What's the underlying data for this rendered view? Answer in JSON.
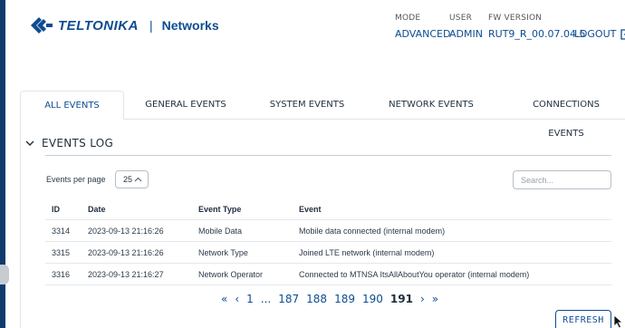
{
  "brand": {
    "logo_text": "TELTONIKA",
    "separator": "|",
    "product": "Networks",
    "color": "#0e4c92"
  },
  "header": {
    "mode": {
      "caption": "MODE",
      "value": "ADVANCED"
    },
    "user": {
      "caption": "USER",
      "value": "ADMIN"
    },
    "fw": {
      "caption": "FW VERSION",
      "value": "RUT9_R_00.07.04.5"
    },
    "logout_label": "LOGOUT",
    "logout_icon": "logout-icon"
  },
  "tabs": [
    {
      "label": "ALL EVENTS",
      "active": true
    },
    {
      "label": "GENERAL EVENTS",
      "active": false
    },
    {
      "label": "SYSTEM EVENTS",
      "active": false
    },
    {
      "label": "NETWORK EVENTS",
      "active": false
    },
    {
      "label": "CONNECTIONS EVENTS",
      "active": false
    }
  ],
  "section": {
    "title": "EVENTS LOG",
    "icon": "chevron-down-icon"
  },
  "controls": {
    "per_page_label": "Events per page",
    "per_page_value": "25",
    "search_placeholder": "Search..."
  },
  "table": {
    "columns": [
      "ID",
      "Date",
      "Event Type",
      "Event"
    ],
    "rows": [
      [
        "3314",
        "2023-09-13 21:16:26",
        "Mobile Data",
        "Mobile data connected (internal modem)"
      ],
      [
        "3315",
        "2023-09-13 21:16:26",
        "Network Type",
        "Joined LTE network (internal modem)"
      ],
      [
        "3316",
        "2023-09-13 21:16:27",
        "Network Operator",
        "Connected to MTNSA ItsAllAboutYou operator (internal modem)"
      ]
    ]
  },
  "pagination": {
    "first": "«",
    "prev": "‹",
    "pages": [
      "1",
      "...",
      "187",
      "188",
      "189",
      "190",
      "191"
    ],
    "current": "191",
    "next": "›",
    "last": "»"
  },
  "refresh_label": "REFRESH",
  "colors": {
    "accent": "#0e4c92",
    "rail": "#0e3a6e"
  }
}
